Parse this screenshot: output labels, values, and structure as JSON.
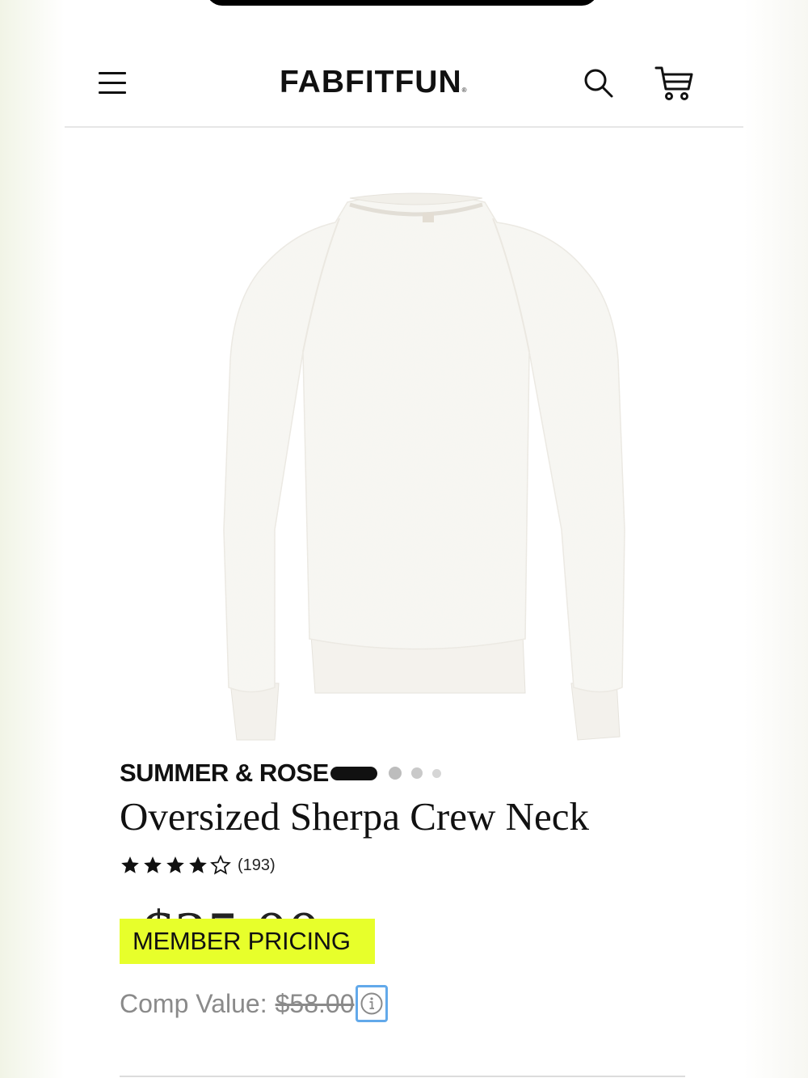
{
  "header": {
    "logo_text": "FABFITFUN",
    "logo_mark": "®",
    "menu_icon": "hamburger-menu-icon",
    "search_icon": "search-icon",
    "cart_icon": "cart-icon"
  },
  "product": {
    "image_alt": "Oversized Sherpa Crew Neck white sweater",
    "brand": "SUMMER & ROSE",
    "title": "Oversized Sherpa Crew Neck",
    "rating": {
      "stars": 4,
      "max_stars": 5,
      "review_count": "(193)"
    },
    "carousel": {
      "total": 4,
      "active_index": 0
    },
    "price": {
      "obscured_price": "$25.00",
      "member_badge": "MEMBER PRICING",
      "comp_label": "Comp Value:",
      "comp_value": "$58.00",
      "info_icon": "info-icon"
    }
  },
  "colors": {
    "badge": "#e7ff2b",
    "focus_outline": "#62a9ea",
    "text_muted": "#8a8a8a",
    "text_primary": "#111111"
  }
}
